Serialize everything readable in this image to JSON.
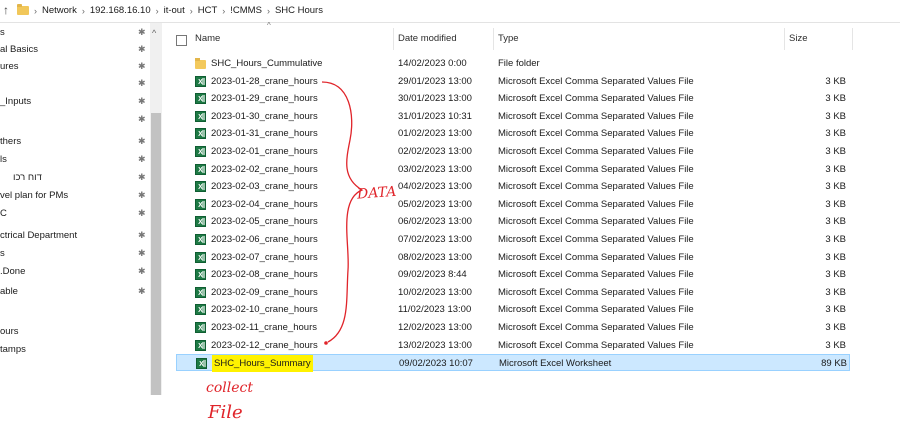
{
  "address_bar": {
    "crumbs": [
      "Network",
      "192.168.16.10",
      "it-out",
      "HCT",
      "!CMMS",
      "SHC Hours"
    ],
    "separator": "›"
  },
  "nav": {
    "items": [
      {
        "label": "s",
        "pinned": true
      },
      {
        "label": "al Basics",
        "pinned": true
      },
      {
        "label": "ures",
        "pinned": true
      },
      {
        "label": "",
        "pinned": true
      },
      {
        "label": "_Inputs",
        "pinned": true
      },
      {
        "label": "",
        "pinned": true
      },
      {
        "label": "thers",
        "pinned": true
      },
      {
        "label": "ls",
        "pinned": true
      },
      {
        "label": "דוח רכו",
        "pinned": true
      },
      {
        "label": "vel plan for PMs",
        "pinned": true
      },
      {
        "label": "C",
        "pinned": true
      },
      {
        "label": "ctrical Department",
        "pinned": true
      },
      {
        "label": "s",
        "pinned": true
      },
      {
        "label": ".Done",
        "pinned": true
      },
      {
        "label": "able",
        "pinned": true
      },
      {
        "label": "",
        "pinned": false
      },
      {
        "label": "ours",
        "pinned": false
      },
      {
        "label": "tamps",
        "pinned": false
      }
    ]
  },
  "columns": {
    "name": "Name",
    "date": "Date modified",
    "type": "Type",
    "size": "Size"
  },
  "files": [
    {
      "name": "SHC_Hours_Cummulative",
      "date": "14/02/2023 0:00",
      "type": "File folder",
      "size": "",
      "icon": "folder"
    },
    {
      "name": "2023-01-28_crane_hours",
      "date": "29/01/2023 13:00",
      "type": "Microsoft Excel Comma Separated Values File",
      "size": "3 KB",
      "icon": "excel"
    },
    {
      "name": "2023-01-29_crane_hours",
      "date": "30/01/2023 13:00",
      "type": "Microsoft Excel Comma Separated Values File",
      "size": "3 KB",
      "icon": "excel"
    },
    {
      "name": "2023-01-30_crane_hours",
      "date": "31/01/2023 10:31",
      "type": "Microsoft Excel Comma Separated Values File",
      "size": "3 KB",
      "icon": "excel"
    },
    {
      "name": "2023-01-31_crane_hours",
      "date": "01/02/2023 13:00",
      "type": "Microsoft Excel Comma Separated Values File",
      "size": "3 KB",
      "icon": "excel"
    },
    {
      "name": "2023-02-01_crane_hours",
      "date": "02/02/2023 13:00",
      "type": "Microsoft Excel Comma Separated Values File",
      "size": "3 KB",
      "icon": "excel"
    },
    {
      "name": "2023-02-02_crane_hours",
      "date": "03/02/2023 13:00",
      "type": "Microsoft Excel Comma Separated Values File",
      "size": "3 KB",
      "icon": "excel"
    },
    {
      "name": "2023-02-03_crane_hours",
      "date": "04/02/2023 13:00",
      "type": "Microsoft Excel Comma Separated Values File",
      "size": "3 KB",
      "icon": "excel"
    },
    {
      "name": "2023-02-04_crane_hours",
      "date": "05/02/2023 13:00",
      "type": "Microsoft Excel Comma Separated Values File",
      "size": "3 KB",
      "icon": "excel"
    },
    {
      "name": "2023-02-05_crane_hours",
      "date": "06/02/2023 13:00",
      "type": "Microsoft Excel Comma Separated Values File",
      "size": "3 KB",
      "icon": "excel"
    },
    {
      "name": "2023-02-06_crane_hours",
      "date": "07/02/2023 13:00",
      "type": "Microsoft Excel Comma Separated Values File",
      "size": "3 KB",
      "icon": "excel"
    },
    {
      "name": "2023-02-07_crane_hours",
      "date": "08/02/2023 13:00",
      "type": "Microsoft Excel Comma Separated Values File",
      "size": "3 KB",
      "icon": "excel"
    },
    {
      "name": "2023-02-08_crane_hours",
      "date": "09/02/2023 8:44",
      "type": "Microsoft Excel Comma Separated Values File",
      "size": "3 KB",
      "icon": "excel"
    },
    {
      "name": "2023-02-09_crane_hours",
      "date": "10/02/2023 13:00",
      "type": "Microsoft Excel Comma Separated Values File",
      "size": "3 KB",
      "icon": "excel"
    },
    {
      "name": "2023-02-10_crane_hours",
      "date": "11/02/2023 13:00",
      "type": "Microsoft Excel Comma Separated Values File",
      "size": "3 KB",
      "icon": "excel"
    },
    {
      "name": "2023-02-11_crane_hours",
      "date": "12/02/2023 13:00",
      "type": "Microsoft Excel Comma Separated Values File",
      "size": "3 KB",
      "icon": "excel"
    },
    {
      "name": "2023-02-12_crane_hours",
      "date": "13/02/2023 13:00",
      "type": "Microsoft Excel Comma Separated Values File",
      "size": "3 KB",
      "icon": "excel"
    },
    {
      "name": "SHC_Hours_Summary",
      "date": "09/02/2023 10:07",
      "type": "Microsoft Excel Worksheet",
      "size": "89 KB",
      "icon": "excel",
      "selected": true,
      "highlighted": true
    }
  ],
  "annotations": {
    "data_label": "DATA",
    "collect_label": "collect",
    "file_label": "File",
    "color": "#e0242a"
  },
  "colors": {
    "selection": "#cce8ff",
    "highlight": "#fff200",
    "excel": "#1e7a45"
  }
}
